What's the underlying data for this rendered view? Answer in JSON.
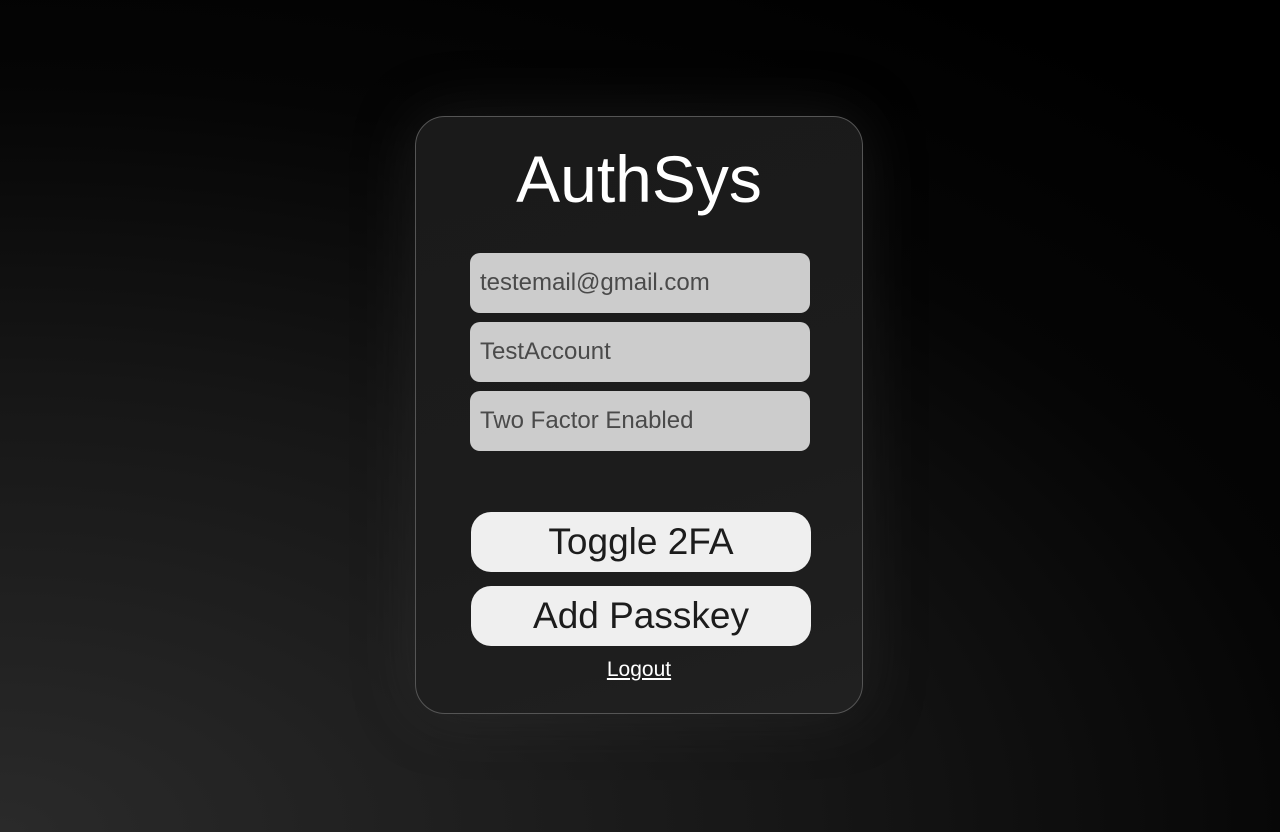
{
  "app": {
    "title": "AuthSys"
  },
  "account": {
    "email": "testemail@gmail.com",
    "username": "TestAccount",
    "two_factor_status": "Two Factor Enabled"
  },
  "actions": {
    "toggle_2fa_label": "Toggle 2FA",
    "add_passkey_label": "Add Passkey",
    "logout_label": "Logout"
  },
  "colors": {
    "card_border": "#555555",
    "field_background": "#cccccc",
    "field_text": "#4a4a4a",
    "button_background": "#efefef",
    "button_text": "#1c1c1c",
    "title_text": "#ffffff"
  }
}
